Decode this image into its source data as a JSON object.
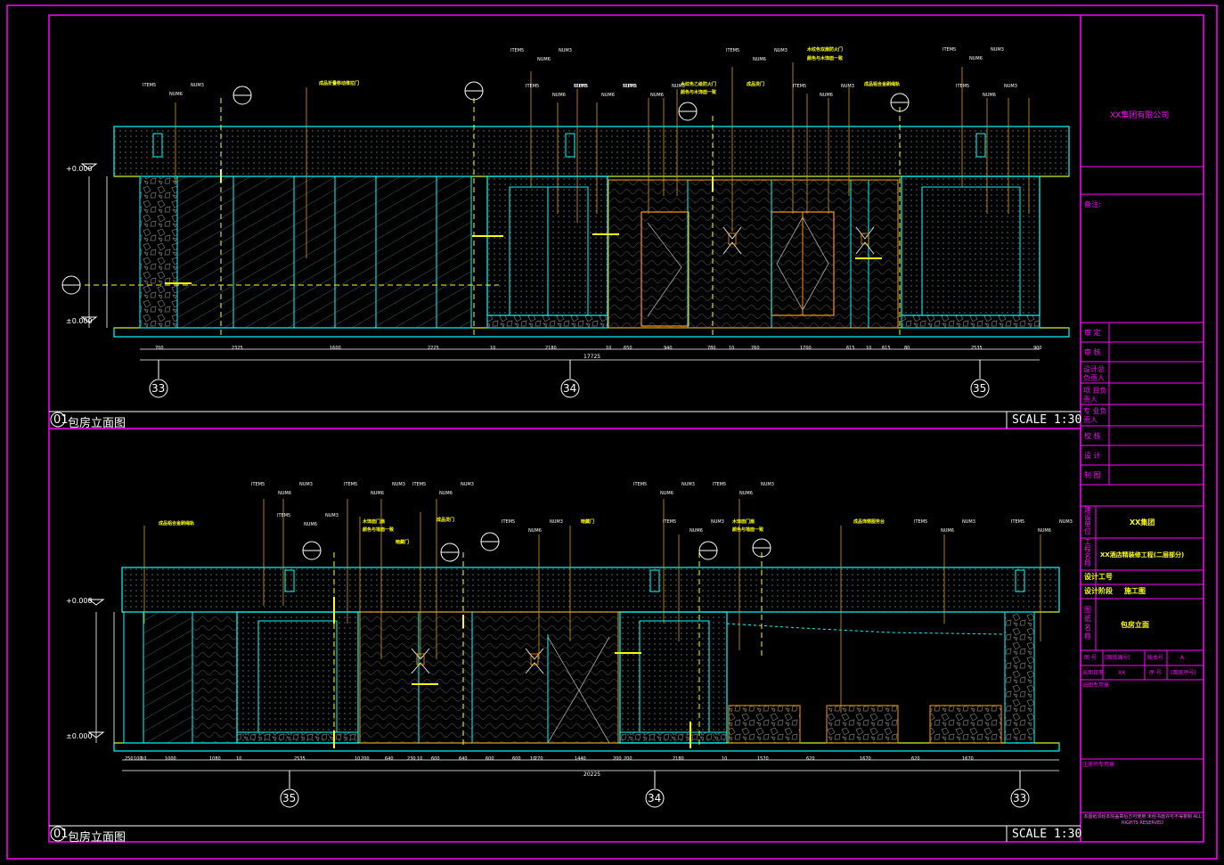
{
  "sheet": {
    "company": "XX集团有限公司",
    "remarks_label": "备注:",
    "drawing_title": "包房立面图",
    "drawing_no": "01",
    "scale": "SCALE 1:30",
    "levels": {
      "top": "+0.000",
      "bottom": "±0.000"
    },
    "upper_axes": [
      "33",
      "34",
      "35"
    ],
    "lower_axes": [
      "35",
      "34",
      "33"
    ],
    "upper_dims": [
      "700",
      "2325",
      "1600",
      "2225",
      "10",
      "2180",
      "10",
      "650",
      "940",
      "780",
      "10",
      "760",
      "1700",
      "615",
      "10",
      "615",
      "80",
      "2535",
      "900"
    ],
    "upper_total": "17725",
    "lower_dims": [
      "250",
      "100",
      "10",
      "1000",
      "1080",
      "10",
      "2535",
      "10",
      "200",
      "640",
      "230",
      "10",
      "600",
      "640",
      "600",
      "600",
      "10",
      "270",
      "1440",
      "200",
      "200",
      "2180",
      "10",
      "1570",
      "620",
      "1670",
      "620",
      "1670"
    ],
    "lower_total": "20225",
    "upper_labels": [
      "成品折叠移动推拉门",
      "木纹色双扇防火门",
      "颜色与木饰面一致",
      "木纹色乙级防火门",
      "颜色与木饰面一致",
      "成品烫门",
      "成品铝合金刷绳轨"
    ],
    "lower_labels": [
      "成品铝合金刷绳轨",
      "木饰面门扇",
      "颜色与墙面一致",
      "暗藏门",
      "成品烫门",
      "暗藏门",
      "木饰面门扇",
      "颜色与墙面一致",
      "成品饰侧服务台"
    ],
    "item_tag": "ITEM5",
    "item_sub": "NUM6",
    "item_num": "NUM3"
  },
  "title_block": {
    "review": "审  定",
    "check": "审  核",
    "design_lead": "设计总负责人",
    "project_lead": "项  目负责人",
    "discipline_lead": "专  业负责人",
    "proofread": "校  核",
    "design": "设  计",
    "drafting": "制  图",
    "client_label": "建设单位",
    "client_value": "XX集团",
    "project_label": "工程名称",
    "project_value": "XX酒店精装修工程(二层部分)",
    "design_no_label": "设计工号",
    "stage_label": "设计阶段",
    "stage_value": "施工图",
    "drawing_name_label": "图纸名称",
    "drawing_name_value": "包房立面",
    "drawing_num_label": "图  号",
    "drawing_num_value": "(图纸编号)",
    "version_label": "版本号",
    "version_value": "A",
    "date_label": "出图日期",
    "date_value": "XX",
    "seq_label": "序  号",
    "seq_value": "(图纸序号)",
    "stamp1": "出图专用章",
    "stamp2": "注册师专用章",
    "copyright": "本图纸须经本院盖章后方可使用 未经书面许可不得复制 ALL RIGHTS RESERVED"
  },
  "colors": {
    "frame": "#ff00ff",
    "cyan": "#00ffff",
    "yellow": "#ffff00",
    "orange": "#ff9900",
    "white": "#ffffff",
    "green": "#9cff3a"
  }
}
